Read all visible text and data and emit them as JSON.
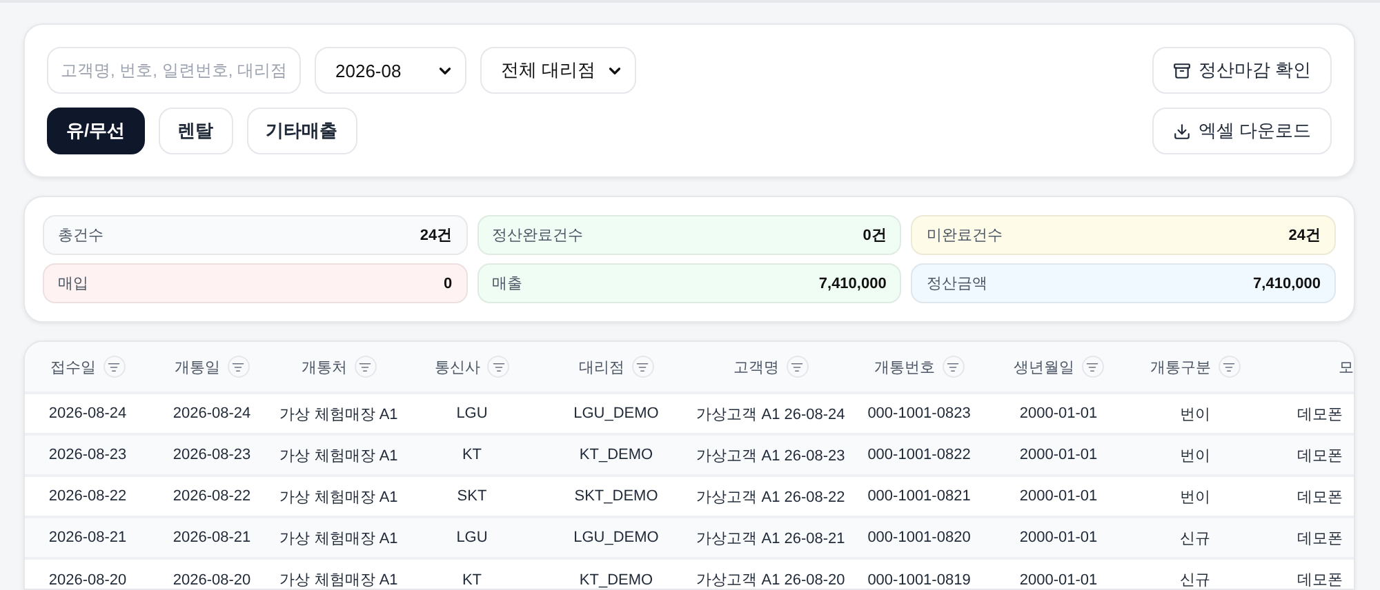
{
  "filters": {
    "search": {
      "placeholder": "고객명, 번호, 일련번호, 대리점"
    },
    "month": {
      "value": "2026-08"
    },
    "agency": {
      "value": "전체 대리점"
    }
  },
  "tabs": [
    {
      "label": "유/무선",
      "selected": true
    },
    {
      "label": "렌탈",
      "selected": false
    },
    {
      "label": "기타매출",
      "selected": false
    }
  ],
  "actions": [
    {
      "kind": "close",
      "label": "정산마감 확인"
    },
    {
      "kind": "download",
      "label": "엑셀 다운로드"
    }
  ],
  "stats": [
    {
      "label": "총건수",
      "value": "24건",
      "color": "#f8fafc"
    },
    {
      "label": "정산완료건수",
      "value": "0건",
      "color": "#f0fdf4"
    },
    {
      "label": "미완료건수",
      "value": "24건",
      "color": "#fefce8"
    },
    {
      "label": "매입",
      "value": "0",
      "color": "#fef2f2"
    },
    {
      "label": "매출",
      "value": "7,410,000",
      "color": "#f0fdf4"
    },
    {
      "label": "정산금액",
      "value": "7,410,000",
      "color": "#f0f9ff"
    }
  ],
  "table": {
    "columns": [
      "접수일",
      "개통일",
      "개통처",
      "통신사",
      "대리점",
      "고객명",
      "개통번호",
      "생년월일",
      "개통구분",
      "모"
    ],
    "rows": [
      [
        "2026-08-24",
        "2026-08-24",
        "가상 체험매장 A1",
        "LGU",
        "LGU_DEMO",
        "가상고객 A1 26-08-24",
        "000-1001-0823",
        "2000-01-01",
        "번이",
        "데모폰"
      ],
      [
        "2026-08-23",
        "2026-08-23",
        "가상 체험매장 A1",
        "KT",
        "KT_DEMO",
        "가상고객 A1 26-08-23",
        "000-1001-0822",
        "2000-01-01",
        "번이",
        "데모폰"
      ],
      [
        "2026-08-22",
        "2026-08-22",
        "가상 체험매장 A1",
        "SKT",
        "SKT_DEMO",
        "가상고객 A1 26-08-22",
        "000-1001-0821",
        "2000-01-01",
        "번이",
        "데모폰"
      ],
      [
        "2026-08-21",
        "2026-08-21",
        "가상 체험매장 A1",
        "LGU",
        "LGU_DEMO",
        "가상고객 A1 26-08-21",
        "000-1001-0820",
        "2000-01-01",
        "신규",
        "데모폰"
      ],
      [
        "2026-08-20",
        "2026-08-20",
        "가상 체험매장 A1",
        "KT",
        "KT_DEMO",
        "가상고객 A1 26-08-20",
        "000-1001-0819",
        "2000-01-01",
        "신규",
        "데모폰"
      ]
    ]
  }
}
